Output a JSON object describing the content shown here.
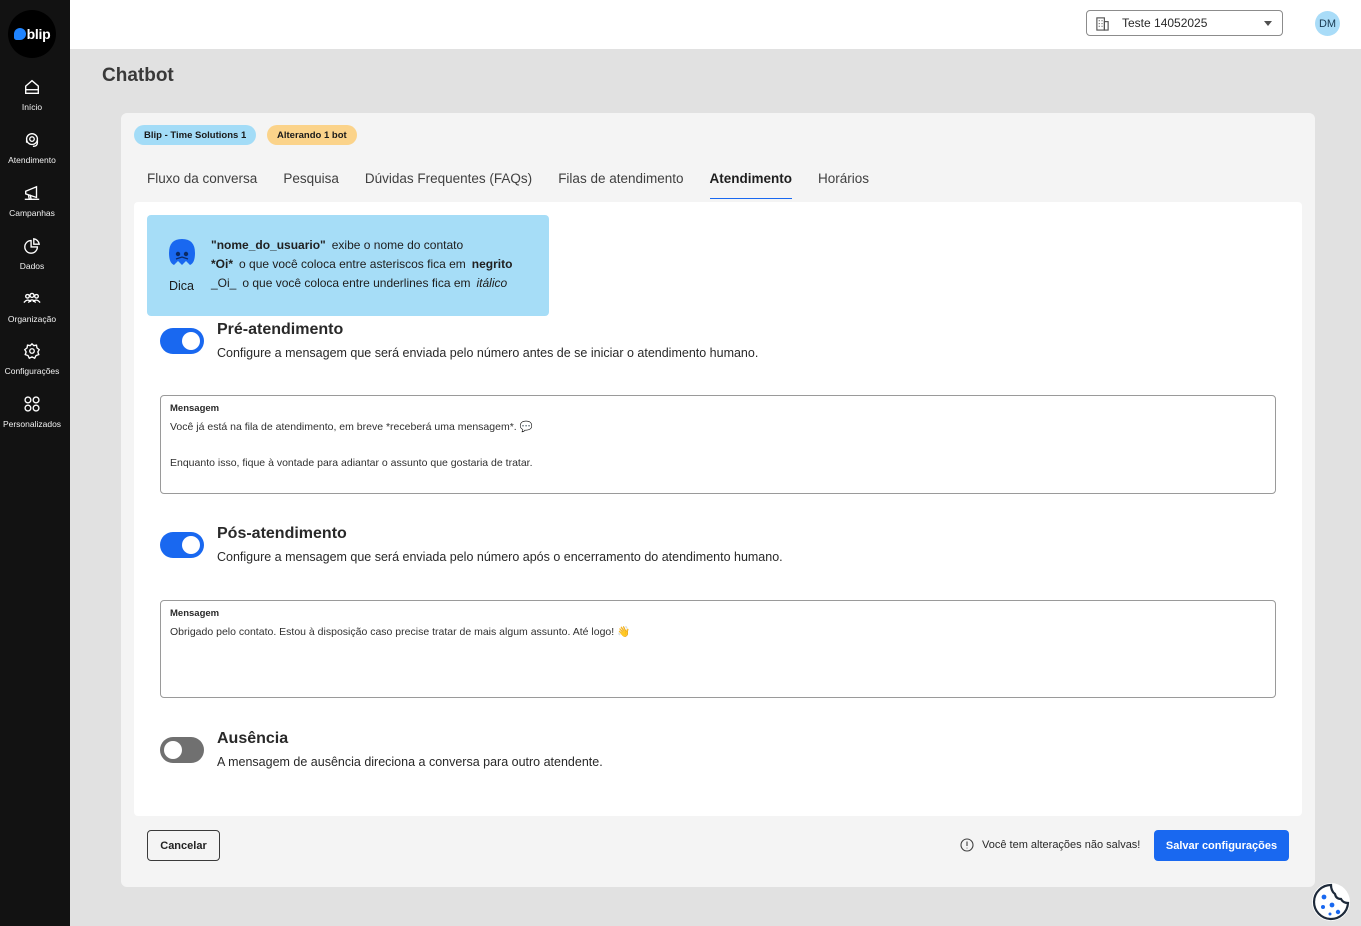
{
  "sidebar": {
    "logo_text": "blip",
    "items": [
      {
        "label": "Início",
        "icon": "home-icon"
      },
      {
        "label": "Atendimento",
        "icon": "headset-icon"
      },
      {
        "label": "Campanhas",
        "icon": "megaphone-icon"
      },
      {
        "label": "Dados",
        "icon": "pie-chart-icon"
      },
      {
        "label": "Organização",
        "icon": "people-icon"
      },
      {
        "label": "Configurações",
        "icon": "gear-icon"
      },
      {
        "label": "Personalizados",
        "icon": "grid-icon"
      }
    ]
  },
  "header": {
    "tenant": "Teste 14052025",
    "avatar_initials": "DM"
  },
  "page": {
    "title": "Chatbot"
  },
  "chips": {
    "bot": "Blip - Time Solutions 1",
    "altering": "Alterando 1 bot"
  },
  "tabs": [
    {
      "label": "Fluxo da conversa",
      "active": false
    },
    {
      "label": "Pesquisa",
      "active": false
    },
    {
      "label": "Dúvidas Frequentes (FAQs)",
      "active": false
    },
    {
      "label": "Filas de atendimento",
      "active": false
    },
    {
      "label": "Atendimento",
      "active": true
    },
    {
      "label": "Horários",
      "active": false
    }
  ],
  "tip": {
    "label": "Dica",
    "line1_code": "\"nome_do_usuario\"",
    "line1_text": "exibe o nome do contato",
    "line2_code": "*Oi*",
    "line2_text": "o que você coloca entre asteriscos fica em",
    "line2_emph": "negrito",
    "line3_code": "_Oi_",
    "line3_text": "o que você coloca entre underlines fica em",
    "line3_emph": "itálico"
  },
  "pre": {
    "enabled": true,
    "title": "Pré-atendimento",
    "description": "Configure a mensagem que será enviada pelo número antes de se iniciar o atendimento humano.",
    "message_label": "Mensagem",
    "message": "Você já está na fila de atendimento, em breve *receberá uma mensagem*. 💬\n\nEnquanto isso, fique à vontade para adiantar o assunto que gostaria de tratar."
  },
  "post": {
    "enabled": true,
    "title": "Pós-atendimento",
    "description": "Configure a mensagem que será enviada pelo número após o encerramento do atendimento humano.",
    "message_label": "Mensagem",
    "message": "Obrigado pelo contato. Estou à disposição caso precise tratar de mais algum assunto. Até logo! 👋"
  },
  "absence": {
    "enabled": false,
    "title": "Ausência",
    "description": "A mensagem de ausência direciona a conversa para outro atendente."
  },
  "footer": {
    "cancel": "Cancelar",
    "warning": "Você tem alterações não salvas!",
    "save": "Salvar configurações"
  },
  "colors": {
    "primary": "#1968f0",
    "sidebar": "#121212",
    "chip_bot": "#a3dcf7",
    "chip_alt": "#fbd38a",
    "tip_bg": "#a6ddf7"
  }
}
